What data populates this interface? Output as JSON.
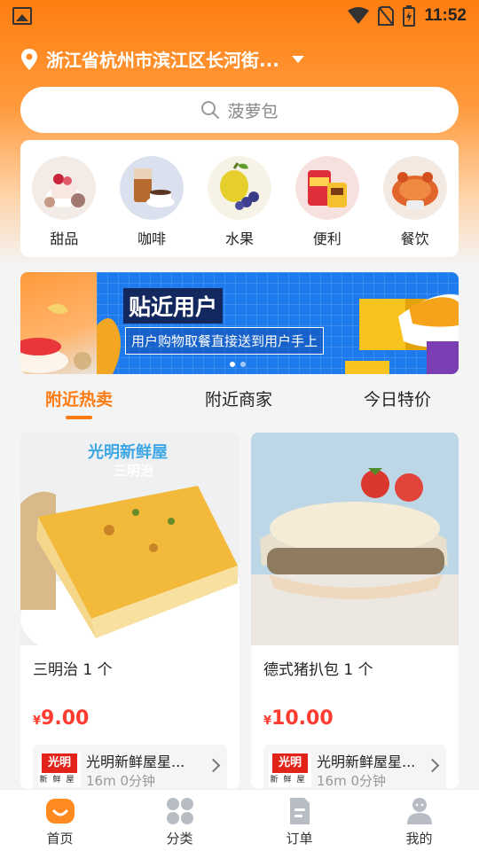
{
  "status_bar": {
    "time": "11:52"
  },
  "location": {
    "address": "浙江省杭州市滨江区长河街..."
  },
  "search": {
    "placeholder": "菠萝包"
  },
  "categories": [
    {
      "label": "甜品",
      "icon": "dessert-icon"
    },
    {
      "label": "咖啡",
      "icon": "coffee-icon"
    },
    {
      "label": "水果",
      "icon": "fruit-icon"
    },
    {
      "label": "便利",
      "icon": "convenience-icon"
    },
    {
      "label": "餐饮",
      "icon": "dining-icon"
    }
  ],
  "banner": {
    "headline": "贴近用户",
    "subtitle": "用户购物取餐直接送到用户手上",
    "current_slide": 1,
    "slide_count": 2
  },
  "tabs": [
    {
      "label": "附近热卖",
      "active": true
    },
    {
      "label": "附近商家",
      "active": false
    },
    {
      "label": "今日特价",
      "active": false
    }
  ],
  "products": [
    {
      "photo_caption_top": "光明新鲜屋",
      "photo_caption_bottom": "三明治",
      "name": "三明治 1 个",
      "currency": "¥",
      "price": "9.00",
      "shop_logo_text": "光明",
      "shop_logo_sub": "新鲜屋",
      "shop_name": "光明新鲜屋星...",
      "shop_meta": "16m 0分钟"
    },
    {
      "name": "德式猪扒包 1 个",
      "currency": "¥",
      "price": "10.00",
      "shop_logo_text": "光明",
      "shop_logo_sub": "新鲜屋",
      "shop_name": "光明新鲜屋星...",
      "shop_meta": "16m 0分钟"
    }
  ],
  "bottom_nav": [
    {
      "label": "首页",
      "active": true
    },
    {
      "label": "分类",
      "active": false
    },
    {
      "label": "订单",
      "active": false
    },
    {
      "label": "我的",
      "active": false
    }
  ],
  "colors": {
    "accent": "#ff7b12",
    "price": "#ff3b30",
    "banner_blue": "#1e7bee"
  }
}
